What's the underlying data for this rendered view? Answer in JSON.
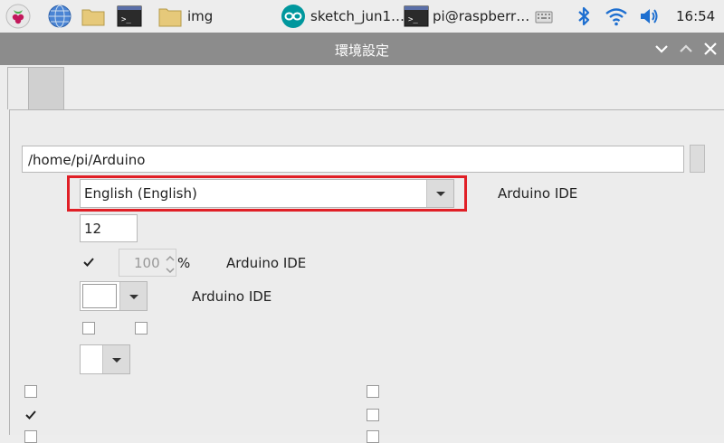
{
  "taskbar": {
    "items": [
      {
        "name": "raspberry-menu",
        "icon": "raspberry-icon"
      },
      {
        "name": "web-browser",
        "icon": "globe-icon"
      },
      {
        "name": "file-manager",
        "icon": "folder-icon"
      },
      {
        "name": "terminal",
        "icon": "terminal-icon"
      },
      {
        "name": "img-window",
        "icon": "folder-icon",
        "label": "img"
      },
      {
        "name": "arduino-window",
        "icon": "arduino-icon",
        "label": "sketch_jun1…"
      },
      {
        "name": "terminal-window",
        "icon": "terminal-icon",
        "label": "pi@raspberr…"
      }
    ],
    "tray": {
      "icons": [
        "keyboard-icon",
        "bluetooth-icon",
        "wifi-icon",
        "volume-icon"
      ],
      "clock": "16:54"
    }
  },
  "window": {
    "title": "環境設定",
    "buttons": [
      "chevron-down-icon",
      "chevron-up-icon",
      "close-icon"
    ]
  },
  "prefs": {
    "sketchbook_path": "/home/pi/Arduino",
    "language": "English (English)",
    "language_note": "Arduino IDE",
    "font_size": "12",
    "scale_checked": true,
    "scale_value": "100",
    "scale_unit": "%",
    "scale_note": "Arduino IDE",
    "theme_note": "Arduino IDE",
    "checkboxes_left": [
      false,
      true,
      false
    ],
    "checkboxes_right": [
      false,
      false,
      false
    ]
  },
  "colors": {
    "highlight": "#e01f26",
    "titlebar": "#8c8c8c",
    "panel": "#ececec"
  }
}
